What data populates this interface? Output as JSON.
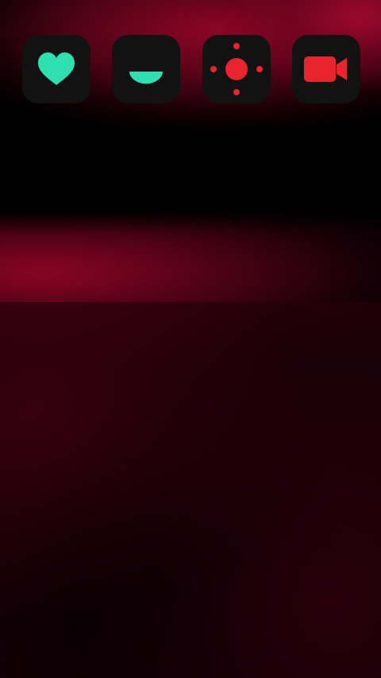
{
  "apps": [
    {
      "icon": "heart-icon",
      "color": "#2ee0b0"
    },
    {
      "icon": "smile-icon",
      "color": "#2ee0b0"
    },
    {
      "icon": "brightness-icon",
      "color": "#e8252f"
    },
    {
      "icon": "video-camera-icon",
      "color": "#e8252f"
    }
  ],
  "colors": {
    "background": "#000000",
    "wallpaper_accent": "#96062a",
    "icon_tile": "#121212"
  }
}
